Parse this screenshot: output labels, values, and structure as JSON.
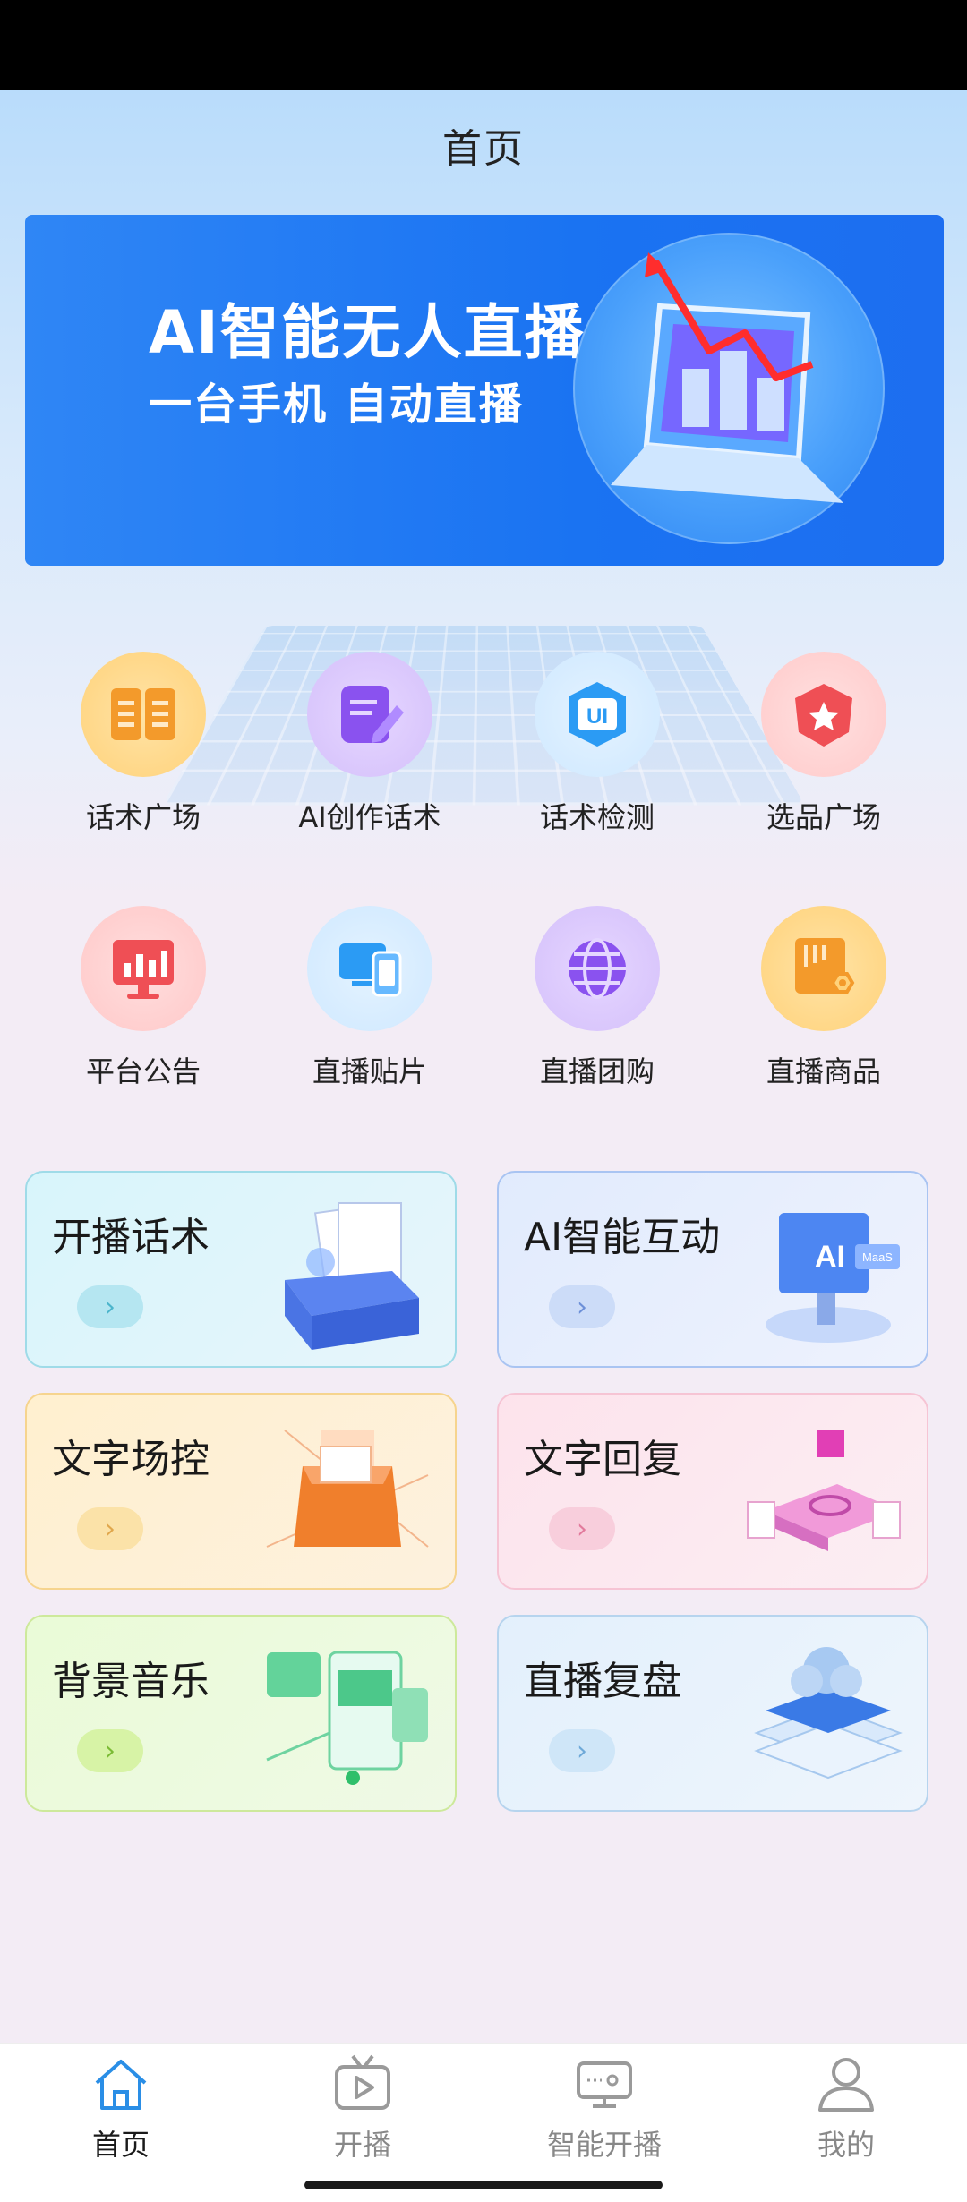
{
  "header": {
    "title": "首页"
  },
  "banner": {
    "title": "AI智能无人直播",
    "subtitle": "一台手机 自动直播"
  },
  "grid": [
    {
      "label": "话术广场",
      "icon": "book-icon",
      "color": "#f8a53a"
    },
    {
      "label": "AI创作话术",
      "icon": "edit-document-icon",
      "color": "#8d5bf2"
    },
    {
      "label": "话术检测",
      "icon": "ui-badge-icon",
      "color": "#2b9bf4"
    },
    {
      "label": "选品广场",
      "icon": "star-shield-icon",
      "color": "#f0595f"
    },
    {
      "label": "平台公告",
      "icon": "chart-monitor-icon",
      "color": "#f0595f"
    },
    {
      "label": "直播贴片",
      "icon": "devices-icon",
      "color": "#2b9bf4"
    },
    {
      "label": "直播团购",
      "icon": "globe-icon",
      "color": "#8d5bf2"
    },
    {
      "label": "直播商品",
      "icon": "box-gear-icon",
      "color": "#f8a53a"
    }
  ],
  "cards": [
    {
      "title": "开播话术",
      "arrow": "›",
      "icon": "document-box-icon"
    },
    {
      "title": "AI智能互动",
      "arrow": "›",
      "icon": "ai-screen-icon"
    },
    {
      "title": "文字场控",
      "arrow": "›",
      "icon": "cube-folder-icon"
    },
    {
      "title": "文字回复",
      "arrow": "›",
      "icon": "platform-icon"
    },
    {
      "title": "背景音乐",
      "arrow": "›",
      "icon": "music-screens-icon"
    },
    {
      "title": "直播复盘",
      "arrow": "›",
      "icon": "cloud-server-icon"
    }
  ],
  "nav": [
    {
      "label": "首页",
      "icon": "home-icon",
      "active": true
    },
    {
      "label": "开播",
      "icon": "tv-play-icon",
      "active": false
    },
    {
      "label": "智能开播",
      "icon": "monitor-icon",
      "active": false
    },
    {
      "label": "我的",
      "icon": "user-icon",
      "active": false
    }
  ]
}
